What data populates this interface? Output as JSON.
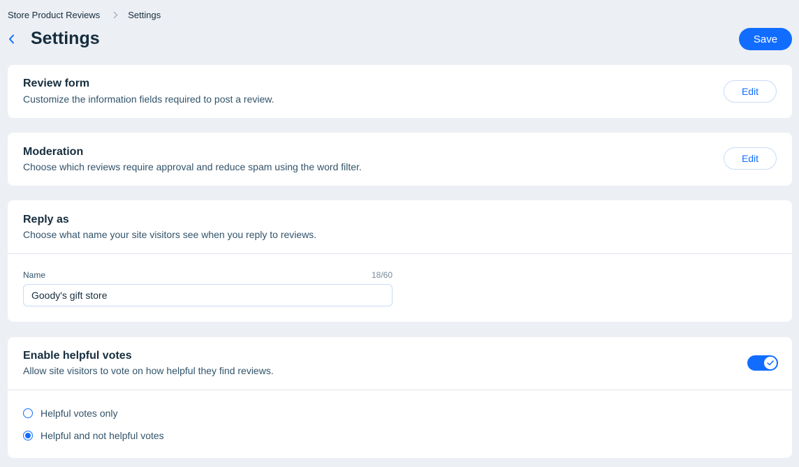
{
  "breadcrumb": {
    "parent": "Store Product Reviews",
    "current": "Settings"
  },
  "header": {
    "title": "Settings",
    "save_label": "Save"
  },
  "review_form": {
    "title": "Review form",
    "description": "Customize the information fields required to post a review.",
    "edit_label": "Edit"
  },
  "moderation": {
    "title": "Moderation",
    "description": "Choose which reviews require approval and reduce spam using the word filter.",
    "edit_label": "Edit"
  },
  "reply_as": {
    "title": "Reply as",
    "description": "Choose what name your site visitors see when you reply to reviews.",
    "field_label": "Name",
    "char_count": "18/60",
    "name_value": "Goody's gift store"
  },
  "helpful_votes": {
    "title": "Enable helpful votes",
    "description": "Allow site visitors to vote on how helpful they find reviews.",
    "enabled": true,
    "options": [
      {
        "label": "Helpful votes only",
        "selected": false
      },
      {
        "label": "Helpful and not helpful votes",
        "selected": true
      }
    ]
  },
  "colors": {
    "accent": "#116dff",
    "page_background": "#eceff4",
    "card_background": "#ffffff",
    "text_primary": "#162d3d"
  },
  "icons": {
    "back": "chevron-left-icon",
    "breadcrumb_separator": "chevron-right-icon",
    "toggle_check": "check-icon"
  }
}
